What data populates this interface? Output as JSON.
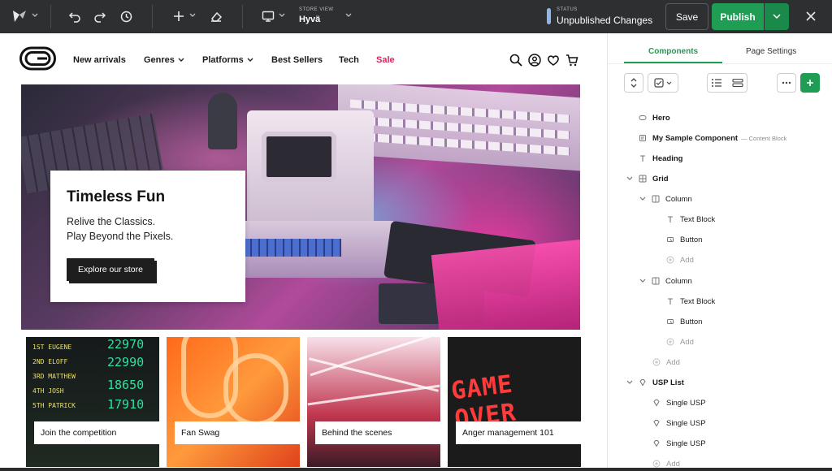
{
  "toolbar": {
    "store_view_label": "STORE VIEW",
    "store_view_value": "Hyvä",
    "status_label": "STATUS",
    "status_value": "Unpublished Changes",
    "save_label": "Save",
    "publish_label": "Publish",
    "status_color": "#8fb6e6",
    "publish_color": "#1f9d55"
  },
  "nav": {
    "items": [
      "New arrivals",
      "Genres",
      "Platforms",
      "Best Sellers",
      "Tech",
      "Sale"
    ],
    "sale_color": "#e0245e"
  },
  "hero": {
    "title": "Timeless Fun",
    "subtitle_line1": "Relive the Classics.",
    "subtitle_line2": "Play Beyond the Pixels.",
    "button_label": "Explore our store"
  },
  "tiles": [
    {
      "caption": "Join the competition"
    },
    {
      "caption": "Fan Swag"
    },
    {
      "caption": "Behind the scenes"
    },
    {
      "caption": "Anger management 101"
    }
  ],
  "scoreboard": {
    "names": [
      "1ST EUGENE",
      "2ND ELOFF",
      "3RD MATTHEW",
      "4TH JOSH",
      "5TH PATRICK"
    ],
    "scores": [
      "22970",
      "22990",
      "18650",
      "17910"
    ]
  },
  "game_over_text": "GAME OVER",
  "panel": {
    "tab_components": "Components",
    "tab_page_settings": "Page Settings",
    "tree": {
      "hero": "Hero",
      "sample": "My Sample Component",
      "sample_type": "— Content Block",
      "heading": "Heading",
      "grid": "Grid",
      "column1": "Column",
      "text_block1": "Text Block",
      "button1": "Button",
      "add1": "Add",
      "column2": "Column",
      "text_block2": "Text Block",
      "button2": "Button",
      "add2": "Add",
      "add3": "Add",
      "usp_list": "USP List",
      "usp1": "Single USP",
      "usp2": "Single USP",
      "usp3": "Single USP",
      "add4": "Add"
    }
  }
}
